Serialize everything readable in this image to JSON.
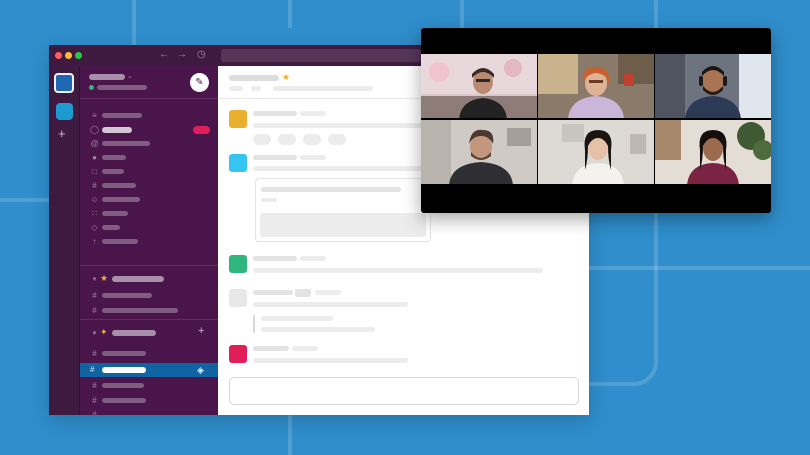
{
  "window": {
    "traffic_lights": [
      "#ff5f57",
      "#febc2e",
      "#28c840"
    ],
    "nav_icons": [
      "back-arrow-icon",
      "forward-arrow-icon",
      "history-clock-icon"
    ]
  },
  "workspace_rail": {
    "workspaces": [
      {
        "color": "#1e67b3",
        "active": true
      },
      {
        "color": "#1d9bd1",
        "active": false
      }
    ],
    "add_icon": "plus-icon"
  },
  "sidebar": {
    "compose_icon": "compose-icon",
    "nav_icons": [
      "threads-icon",
      "dms-icon",
      "mentions-icon",
      "saved-icon",
      "bookmark-icon",
      "channels-icon",
      "people-icon",
      "apps-icon",
      "files-icon",
      "more-icon"
    ],
    "starred_icon": "star-icon",
    "active_channel_icon": "huddle-icon",
    "badge_color": "#e01e5a"
  },
  "channel_header": {
    "star_icon": "star-icon",
    "star_color": "#e8b02e"
  },
  "messages": [
    {
      "avatar_color": "#e8b02e"
    },
    {
      "avatar_color": "#36c5f0"
    },
    {
      "avatar_color": "#2eb67d"
    },
    {
      "avatar_color": "#e8e8e8"
    },
    {
      "avatar_color": "#e01e5a"
    }
  ],
  "video_call": {
    "participants": [
      {
        "position": "top-left"
      },
      {
        "position": "top-center"
      },
      {
        "position": "top-right"
      },
      {
        "position": "bottom-left"
      },
      {
        "position": "bottom-center"
      },
      {
        "position": "bottom-right"
      }
    ]
  },
  "colors": {
    "background": "#2f8ecb",
    "sidebar": "#4a154b",
    "titlebar": "#3e1a41",
    "active_channel": "#1164a3"
  }
}
